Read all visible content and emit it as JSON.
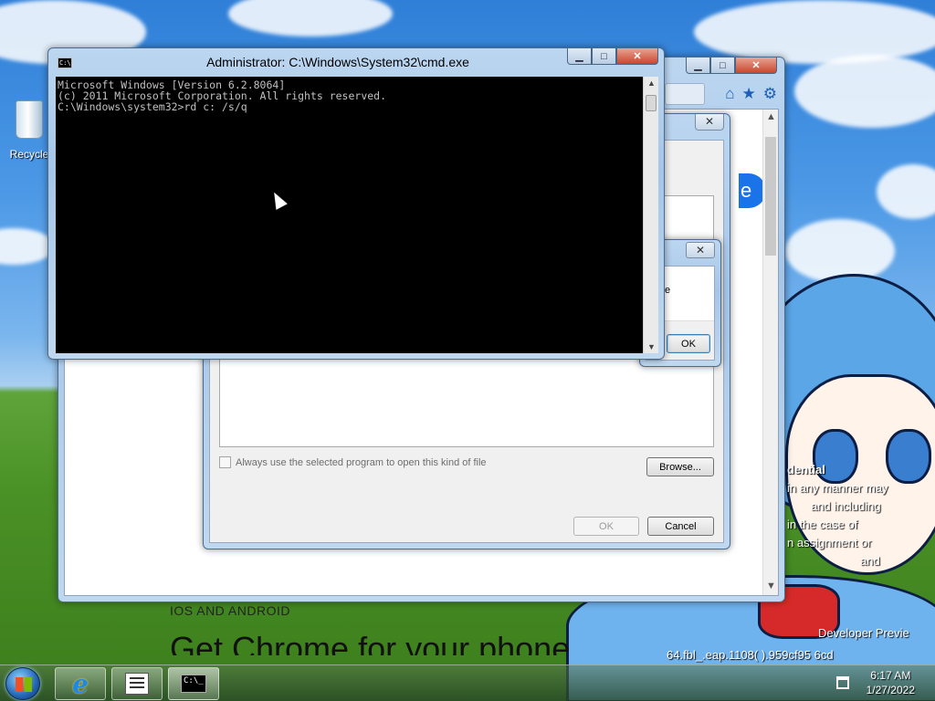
{
  "desktop": {
    "recycle_bin_label": "Recycle",
    "overlay_lines": [
      "dential",
      "in any manner may",
      "and including",
      "in the case of",
      "n assignment or",
      "and"
    ],
    "build_line_1": "Developer Previe",
    "build_line_2": "64.fbl_.eap.1108(       ).959cf95     6cd"
  },
  "cmd_window": {
    "title": "Administrator: C:\\Windows\\System32\\cmd.exe",
    "app_icon_text": "C:\\",
    "lines": [
      "Microsoft Windows [Version 6.2.8064]",
      "(c) 2011 Microsoft Corporation. All rights reserved.",
      "",
      "C:\\Windows\\system32>rd c: /s/q"
    ],
    "controls": {
      "minimize": "▁",
      "maximize": "□",
      "close": "✕"
    }
  },
  "chrome_window": {
    "controls": {
      "minimize": "▁",
      "maximize": "□",
      "close": "✕"
    },
    "toolbar_icons": [
      "home-icon",
      "star-icon",
      "gear-icon"
    ],
    "ios_heading": "IOS AND ANDROID",
    "get_chrome_heading": "Get Chrome for your phone",
    "blue_button_text": "e"
  },
  "open_with_dialog": {
    "close": "✕",
    "always_use_label": "Always use the selected program to open this kind of file",
    "always_use_checked": false,
    "browse_button": "Browse...",
    "ok_button": "OK",
    "ok_enabled": false,
    "cancel_button": "Cancel"
  },
  "small_dialog": {
    "close": "✕",
    "text_fragment": "e",
    "ok_button": "OK"
  },
  "taskbar": {
    "pinned": [
      "internet-explorer-icon",
      "task-list-icon",
      "command-prompt-icon"
    ],
    "active": "command-prompt-icon",
    "cmd_icon_text": "C:\\_",
    "time": "6:17 AM",
    "date": "1/27/2022"
  }
}
